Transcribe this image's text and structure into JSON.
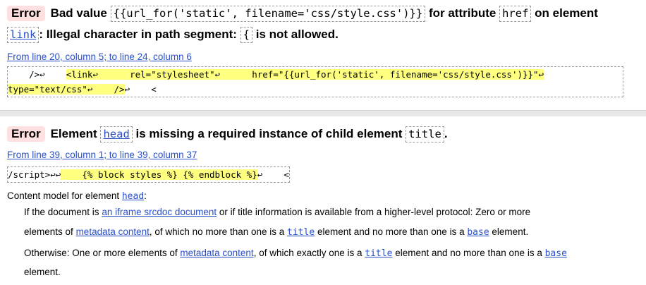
{
  "messages": [
    {
      "type": "Error",
      "prefix": "Bad value",
      "value": "{{url_for('static', filename='css/style.css')}}",
      "for_attribute": "for attribute",
      "attribute": "href",
      "on_element": "on element",
      "element": "link",
      "reason_pre": ": Illegal character in path segment:",
      "char": "{",
      "reason_post": "is not allowed.",
      "location": "From line 20, column 5; to line 24, column 6",
      "extract_line1_a": "    />↩    ",
      "extract_line1_hl": "<link↩      rel=\"stylesheet\"↩      href=\"{{url_for('static', filename='css/style.css')}}\"↩",
      "extract_line2_hl": "type=\"text/css\"↩    />",
      "extract_line2_b": "↩    <"
    },
    {
      "type": "Error",
      "prefix": "Element",
      "element": "head",
      "middle": "is missing a required instance of child element",
      "child": "title",
      "end": ".",
      "location": "From line 39, column 1; to line 39, column 37",
      "extract_a": "/script>↩↩",
      "extract_hl": "    {% block styles %} {% endblock %}",
      "extract_b": "↩    <",
      "content_model_label": "Content model for element",
      "content_model_element": "head",
      "content_model_colon": ":",
      "p1_a": "If the document is",
      "p1_link": "an iframe srcdoc document",
      "p1_b": "or if title information is available from a higher-level protocol: Zero or more",
      "p2_a": "elements of",
      "p2_link": "metadata content",
      "p2_b": ", of which no more than one is a",
      "p2_code": "title",
      "p2_c": "element and no more than one is a",
      "p2_code2": "base",
      "p2_d": "element.",
      "p3_a": "Otherwise: One or more elements of",
      "p3_link": "metadata content",
      "p3_b": ", of which exactly one is a",
      "p3_code": "title",
      "p3_c": "element and no more than one is a",
      "p3_code2": "base",
      "p4": "element."
    }
  ]
}
